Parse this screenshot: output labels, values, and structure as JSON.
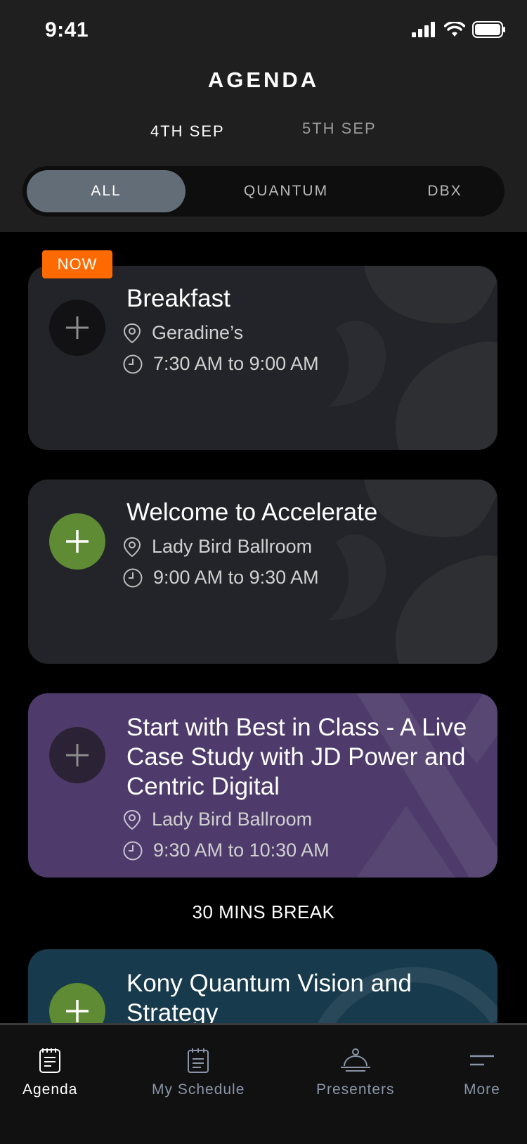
{
  "status": {
    "time": "9:41"
  },
  "header": {
    "title": "AGENDA"
  },
  "dates": [
    {
      "label": "4TH SEP",
      "active": true
    },
    {
      "label": "5TH SEP",
      "active": false
    }
  ],
  "filters": [
    {
      "label": "ALL",
      "active": true
    },
    {
      "label": "QUANTUM"
    },
    {
      "label": "DBX"
    }
  ],
  "now_badge": "NOW",
  "sessions": [
    {
      "title": "Breakfast",
      "location": "Geradine’s",
      "time": "7:30 AM to 9:00 AM",
      "added": false
    },
    {
      "title": "Welcome to Accelerate",
      "location": "Lady Bird Ballroom",
      "time": "9:00 AM to 9:30 AM",
      "added": true
    },
    {
      "title": "Start with Best in Class - A Live Case Study with JD Power and Centric Digital",
      "location": "Lady Bird Ballroom",
      "time": "9:30 AM to 10:30 AM",
      "added": false
    },
    {
      "title": "Kony Quantum Vision and Strategy",
      "added": true
    }
  ],
  "break_label": "30 MINS BREAK",
  "tabbar": [
    {
      "label": "Agenda",
      "icon": "agenda-icon",
      "active": true
    },
    {
      "label": "My Schedule",
      "icon": "schedule-icon"
    },
    {
      "label": "Presenters",
      "icon": "presenters-icon"
    },
    {
      "label": "More",
      "icon": "menu-icon"
    }
  ],
  "colors": {
    "accent_green": "#5e8b34",
    "now_orange": "#ff6a00",
    "purple_card": "#4e3b6b",
    "teal_card": "#173a4c"
  }
}
